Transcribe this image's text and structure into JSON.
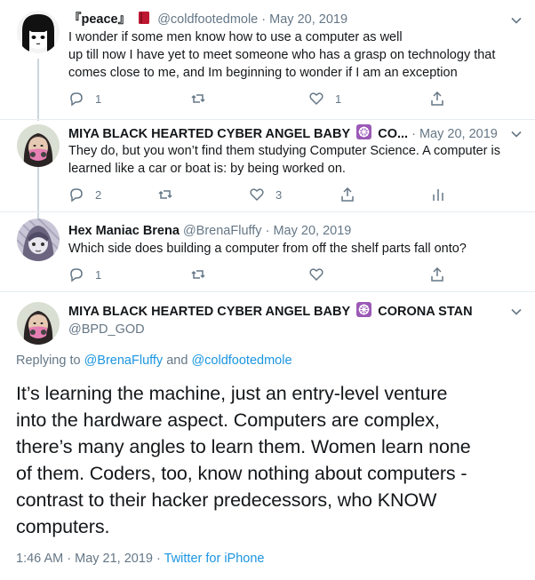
{
  "tweets": [
    {
      "name": "『peace』",
      "handle": "@coldfootedmole",
      "date": "May 20, 2019",
      "lines": [
        "I wonder if some men know how to use a computer as well",
        "up till now I have yet to meet someone who has a grasp on technology that",
        "comes close to me, and Im beginning to wonder if I am an exception"
      ],
      "replies": "1",
      "retweets": "",
      "likes": "1"
    },
    {
      "name": "MIYA BLACK HEARTED CYBER ANGEL BABY",
      "name_suffix": "CO...",
      "date": "May 20, 2019",
      "lines": [
        "They do, but you won’t find them studying Computer Science. A computer is",
        "learned like a car or boat is: by being worked on."
      ],
      "replies": "2",
      "retweets": "",
      "likes": "3"
    },
    {
      "name": "Hex Maniac Brena",
      "handle": "@BrenaFluffy",
      "date": "May 20, 2019",
      "lines": [
        "Which side does building a computer from off the shelf parts fall onto?"
      ],
      "replies": "1",
      "retweets": "",
      "likes": ""
    }
  ],
  "main_tweet": {
    "name": "MIYA BLACK HEARTED CYBER ANGEL BABY",
    "name_suffix": "CORONA STAN",
    "handle": "@BPD_GOD",
    "replying_prefix": "Replying to",
    "reply_to_1": "@BrenaFluffy",
    "reply_and": "and",
    "reply_to_2": "@coldfootedmole",
    "lines": [
      "It’s learning the machine, just an entry-level venture",
      "into the hardware aspect. Computers are complex,",
      "there’s many angles to learn them. Women learn none",
      "of them. Coders, too, know nothing about computers -",
      "contrast to their hacker predecessors, who KNOW",
      "computers."
    ],
    "time": "1:46 AM",
    "date": "May 21, 2019",
    "source": "Twitter for iPhone"
  },
  "separator": "·",
  "colors": {
    "link": "#1b95e0",
    "muted": "#657786",
    "divider": "#e6ecf0",
    "thread_line": "#ccd6dd"
  }
}
